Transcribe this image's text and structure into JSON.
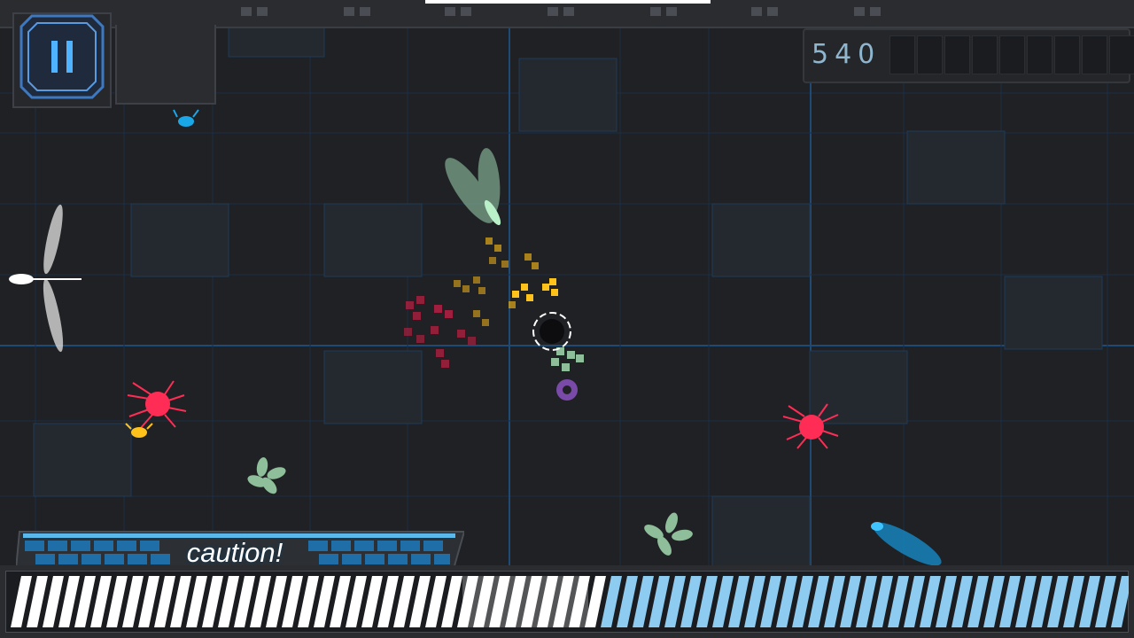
{
  "hud": {
    "pause_icon": "pause-icon",
    "score": "540",
    "score_cells": 10,
    "caution_label": "caution!",
    "meter_level": 0.52,
    "meter_fill_color": "#8dcbf0",
    "meter_white_color": "#ffffff"
  },
  "colors": {
    "background": "#1f2124",
    "grid": "#1d3b57",
    "enemy_red": "#ff2d55",
    "enemy_blue": "#1aa7e8",
    "enemy_yellow": "#ffc21a",
    "plant_green": "#8fbf9a",
    "cursor": "#ffffff",
    "gear": "#7a4aa8"
  }
}
